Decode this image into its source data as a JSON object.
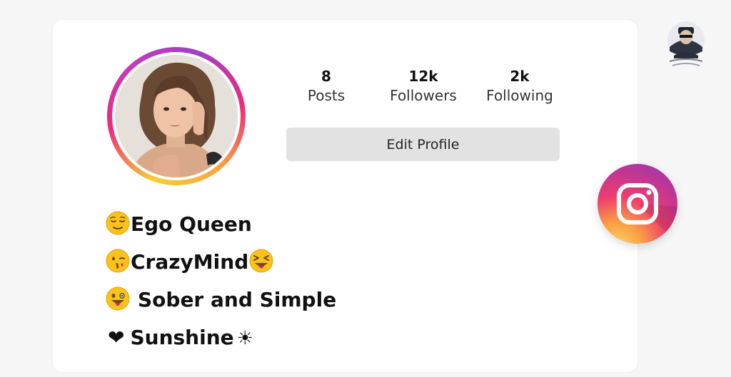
{
  "profile": {
    "stats": {
      "posts_value": "8",
      "posts_label": "Posts",
      "followers_value": "12k",
      "followers_label": "Followers",
      "following_value": "2k",
      "following_label": "Following"
    },
    "edit_profile_label": "Edit Profile",
    "bio": {
      "line1": "Ego Queen",
      "line2": "CrazyMind",
      "line3": "Sober and Simple",
      "line4": "Sunshine",
      "line4_heart": "❤",
      "line4_sun": "☀"
    }
  },
  "icons": {
    "line1_emoji": "relieved-face-icon",
    "line2_emoji_left": "kissing-face-icon",
    "line2_emoji_right": "squinting-tongue-face-icon",
    "line3_emoji": "winking-tongue-face-icon",
    "badge": "instagram-logo-icon",
    "watermark": "attitude-point-logo-icon"
  },
  "colors": {
    "card_bg": "#ffffff",
    "button_bg": "#e2e2e2",
    "ring_gradient": [
      "#f9ce34",
      "#ee2a7b",
      "#a23fc4"
    ],
    "emoji_yellow": "#fcc21b"
  }
}
